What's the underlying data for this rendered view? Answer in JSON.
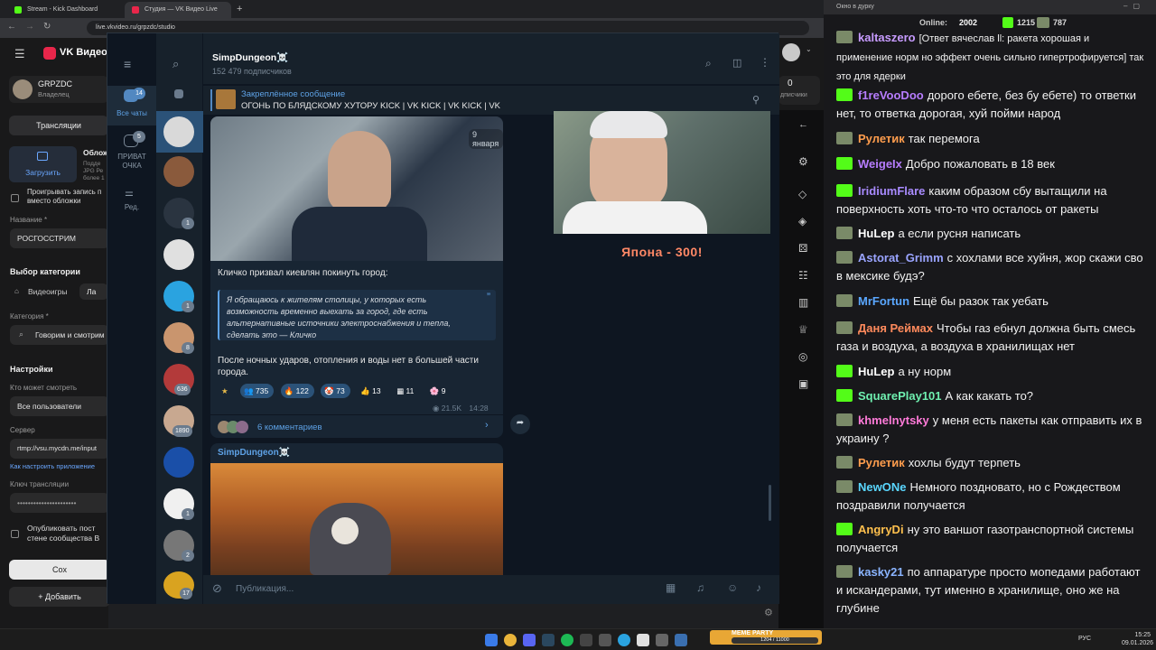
{
  "browser": {
    "tabs": [
      {
        "label": "Stream - Kick Dashboard"
      },
      {
        "label": "Студия — VK Видео Live"
      }
    ],
    "url": "live.vkvideo.ru/grpzdc/studio"
  },
  "vk": {
    "brand": "VK Видео",
    "channel_name": "GRPZDC",
    "channel_role": "Владелец",
    "tab_label": "Трансляции",
    "cover_title": "Облож",
    "cover_desc": "Подде JPG Ре более 1",
    "upload_label": "Загрузить",
    "play_checkbox_label": "Проигрывать запись п вместо обложки",
    "name_label": "Название *",
    "name_value": "РОСГОССТРИМ",
    "category_header": "Выбор категории",
    "category_games": "Видеоигры",
    "category_live": "Ла",
    "category_label": "Категория *",
    "category_value": "Говорим и смотрим",
    "settings_header": "Настройки",
    "who_can_watch_label": "Кто может смотреть",
    "who_can_watch_value": "Все пользователи",
    "server_label": "Сервер",
    "server_value": "rtmp://vsu.mycdn.me/input",
    "setup_link": "Как настроить приложение",
    "stream_key_label": "Ключ трансляции",
    "publish_label": "Опубликовать пост стене сообщества В",
    "save_button": "Сох",
    "add_button": "Добавить",
    "viewers_count": "0",
    "viewers_label": "дписчики"
  },
  "telegram": {
    "folders": [
      {
        "label": "Все чаты",
        "badge": "14"
      },
      {
        "label": "ПРИВАТ ОЧКА",
        "badge": "5"
      },
      {
        "label": "Ред.",
        "badge": ""
      }
    ],
    "chat_badges": [
      "",
      "",
      "1",
      "",
      "1",
      "8",
      "636",
      "1890",
      "",
      "1",
      "2",
      "17"
    ],
    "channel_name": "SimpDungeon☠️",
    "subscribers": "152 479 подписчиков",
    "pinned_title": "Закреплённое сообщение",
    "pinned_text": "ОГОНЬ ПО БЛЯДСКОМУ ХУТОРУ  KICK | VK KICK | VK KICK | VK",
    "date_label": "9 января",
    "post_caption": "Кличко призвал киевлян покинуть город:",
    "quote_text": "Я обращаюсь к жителям столицы, у которых есть возможность временно выехать за город, где есть альтернативные источники электроснабжения и тепла, сделать это — Кличко",
    "post_footer": "После ночных ударов, отопления и воды нет в большей части города.",
    "reactions": [
      {
        "emoji": "★",
        "count": ""
      },
      {
        "emoji": "👥",
        "count": "735"
      },
      {
        "emoji": "🔥",
        "count": "122"
      },
      {
        "emoji": "🤡",
        "count": "73"
      },
      {
        "emoji": "👍",
        "count": "13"
      },
      {
        "emoji": "▦",
        "count": "11"
      },
      {
        "emoji": "🌸",
        "count": "9"
      }
    ],
    "views": "21.5K",
    "time": "14:28",
    "comments": "6 комментариев",
    "next_author": "SimpDungeon☠️",
    "input_placeholder": "Публикация..."
  },
  "video_overlay": {
    "caption": "Япона  - 300!"
  },
  "chat": {
    "window_title": "Окно в дурку",
    "online_label": "Online:",
    "online_count": "2002",
    "kick_count": "1215",
    "vk_count": "787",
    "messages": [
      {
        "nick": "kaltaszero",
        "color": "#c79bff",
        "badge": "av",
        "text": "[Ответ вячеслав ll: ракета хорошая и применение норм но эффект очень сильно гипертрофируется] так это для ядерки"
      },
      {
        "nick": "f1reVooDoo",
        "color": "#b77dff",
        "badge": "k",
        "text": "дорого ебете, без бу ебете) то ответки нет, то ответка дорогая, хуй пойми народ"
      },
      {
        "nick": "Рулетик",
        "color": "#ff9d4d",
        "badge": "av",
        "text": "так перемога"
      },
      {
        "nick": "WeigeIx",
        "color": "#b77dff",
        "badge": "k",
        "text": "Добро пожаловать в 18 век"
      },
      {
        "nick": "IridiumFlare",
        "color": "#a98bff",
        "badge": "k",
        "text": "каким образом сбу вытащили на поверхность хоть что-то что осталось от ракеты"
      },
      {
        "nick": "HuLep",
        "color": "#ffffff",
        "badge": "av",
        "text": "а если русня написать"
      },
      {
        "nick": "Astorat_Grimm",
        "color": "#9aa4ff",
        "badge": "av",
        "text": "с хохлами все хуйня, жор скажи сво в мексике будэ?"
      },
      {
        "nick": "MrFortun",
        "color": "#5aa7ff",
        "badge": "av",
        "text": "Ещё бы разок так уебать"
      },
      {
        "nick": "Даня Реймах",
        "color": "#ff8a5c",
        "badge": "av",
        "text": "Чтобы газ ебнул должна быть смесь газа и воздуха, а воздуха в хранилищах нет"
      },
      {
        "nick": "HuLep",
        "color": "#ffffff",
        "badge": "k",
        "text": "а ну норм"
      },
      {
        "nick": "SquarePlay101",
        "color": "#6ff0b0",
        "badge": "k",
        "text": "А как какать то?"
      },
      {
        "nick": "khmelnytsky",
        "color": "#ff7ad9",
        "badge": "av",
        "text": "у меня есть пакеты как отправить их в украину ?"
      },
      {
        "nick": "Рулетик",
        "color": "#ff9d4d",
        "badge": "av",
        "text": "хохлы будут терпеть"
      },
      {
        "nick": "NewONe",
        "color": "#5ad7ff",
        "badge": "av",
        "text": "Немного поздновато, но с Рождеством поздравили получается"
      },
      {
        "nick": "AngryDi",
        "color": "#ffc04d",
        "badge": "k",
        "text": "ну это ваншот газотранспортной системы получается"
      },
      {
        "nick": "kasky21",
        "color": "#8ab4ff",
        "badge": "av",
        "text": "по аппаратуре просто мопедами работают и искандерами, тут именно в хранилище, оно же на глубине"
      }
    ]
  },
  "taskbar": {
    "lang": "РУС",
    "time": "15:25",
    "date": "09.01.2026",
    "widget_label": "MEME PARTY",
    "widget_progress": "1204 / 11000"
  },
  "colors": {
    "kick_green": "#53fc18",
    "tg_accent": "#5288c1",
    "tg_bubble": "#182533"
  }
}
